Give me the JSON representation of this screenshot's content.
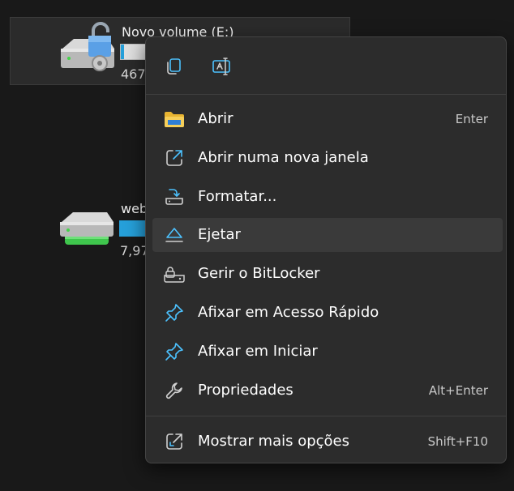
{
  "drives": [
    {
      "name": "Novo volume (E:)",
      "size_text": "467",
      "used_fraction": 0.1
    },
    {
      "name": "web",
      "size_text": "7,97",
      "used_fraction": 1.0
    }
  ],
  "toolbar": {
    "copy_icon": "copy-icon",
    "rename_icon": "rename-icon"
  },
  "menu": {
    "items": [
      {
        "label": "Abrir",
        "shortcut": "Enter",
        "icon": "folder-icon"
      },
      {
        "label": "Abrir numa nova janela",
        "shortcut": "",
        "icon": "open-new-window-icon"
      },
      {
        "label": "Formatar...",
        "shortcut": "",
        "icon": "format-icon"
      },
      {
        "label": "Ejetar",
        "shortcut": "",
        "icon": "eject-icon"
      },
      {
        "label": "Gerir o BitLocker",
        "shortcut": "",
        "icon": "bitlocker-icon"
      },
      {
        "label": "Afixar em Acesso Rápido",
        "shortcut": "",
        "icon": "pin-icon"
      },
      {
        "label": "Afixar em Iniciar",
        "shortcut": "",
        "icon": "pin-start-icon"
      },
      {
        "label": "Propriedades",
        "shortcut": "Alt+Enter",
        "icon": "wrench-icon"
      }
    ],
    "more": {
      "label": "Mostrar mais opções",
      "shortcut": "Shift+F10",
      "icon": "more-options-icon"
    }
  },
  "colors": {
    "accent": "#4cc2ff",
    "folder": "#f0c44c",
    "hover": "#3a3a3a"
  }
}
